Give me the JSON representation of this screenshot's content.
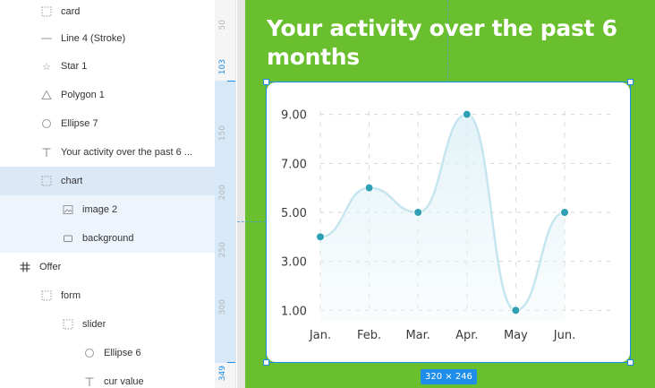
{
  "layers": [
    {
      "label": "card",
      "icon": "frame-grid-icon"
    },
    {
      "label": "Line 4 (Stroke)",
      "icon": "line-icon"
    },
    {
      "label": "Star 1",
      "icon": "star-icon"
    },
    {
      "label": "Polygon 1",
      "icon": "polygon-icon"
    },
    {
      "label": "Ellipse 7",
      "icon": "ellipse-icon"
    },
    {
      "label": "Your activity over the past 6 ...",
      "icon": "text-icon"
    },
    {
      "label": "chart",
      "icon": "frame-grid-icon"
    },
    {
      "label": "image 2",
      "icon": "image-icon"
    },
    {
      "label": "background",
      "icon": "rectangle-icon"
    },
    {
      "label": "Offer",
      "icon": "hash-frame-icon"
    },
    {
      "label": "form",
      "icon": "frame-grid-icon"
    },
    {
      "label": "slider",
      "icon": "frame-grid-icon"
    },
    {
      "label": "Ellipse 6",
      "icon": "ellipse-icon"
    },
    {
      "label": "cur value",
      "icon": "text-icon"
    }
  ],
  "ruler": {
    "labels": [
      "50",
      "103",
      "150",
      "200",
      "250",
      "300",
      "349"
    ],
    "highlighted": [
      "103",
      "349"
    ]
  },
  "canvas": {
    "heading": "Your activity over the past 6 months",
    "selection_size": "320 × 246",
    "frame_color": "#6abf2e",
    "accent_color": "#1e8ee8"
  },
  "chart_data": {
    "type": "line",
    "categories": [
      "Jan.",
      "Feb.",
      "Mar.",
      "Apr.",
      "May",
      "Jun."
    ],
    "values": [
      4.0,
      6.0,
      5.0,
      9.0,
      1.0,
      5.0
    ],
    "y_ticks": [
      "1.00",
      "3.00",
      "5.00",
      "7.00",
      "9.00"
    ],
    "ylim": [
      0.5,
      9.5
    ],
    "smooth": true,
    "area_fill": true,
    "grid": true,
    "line_color": "#c6e6ef",
    "point_color": "#2f9fb5"
  }
}
